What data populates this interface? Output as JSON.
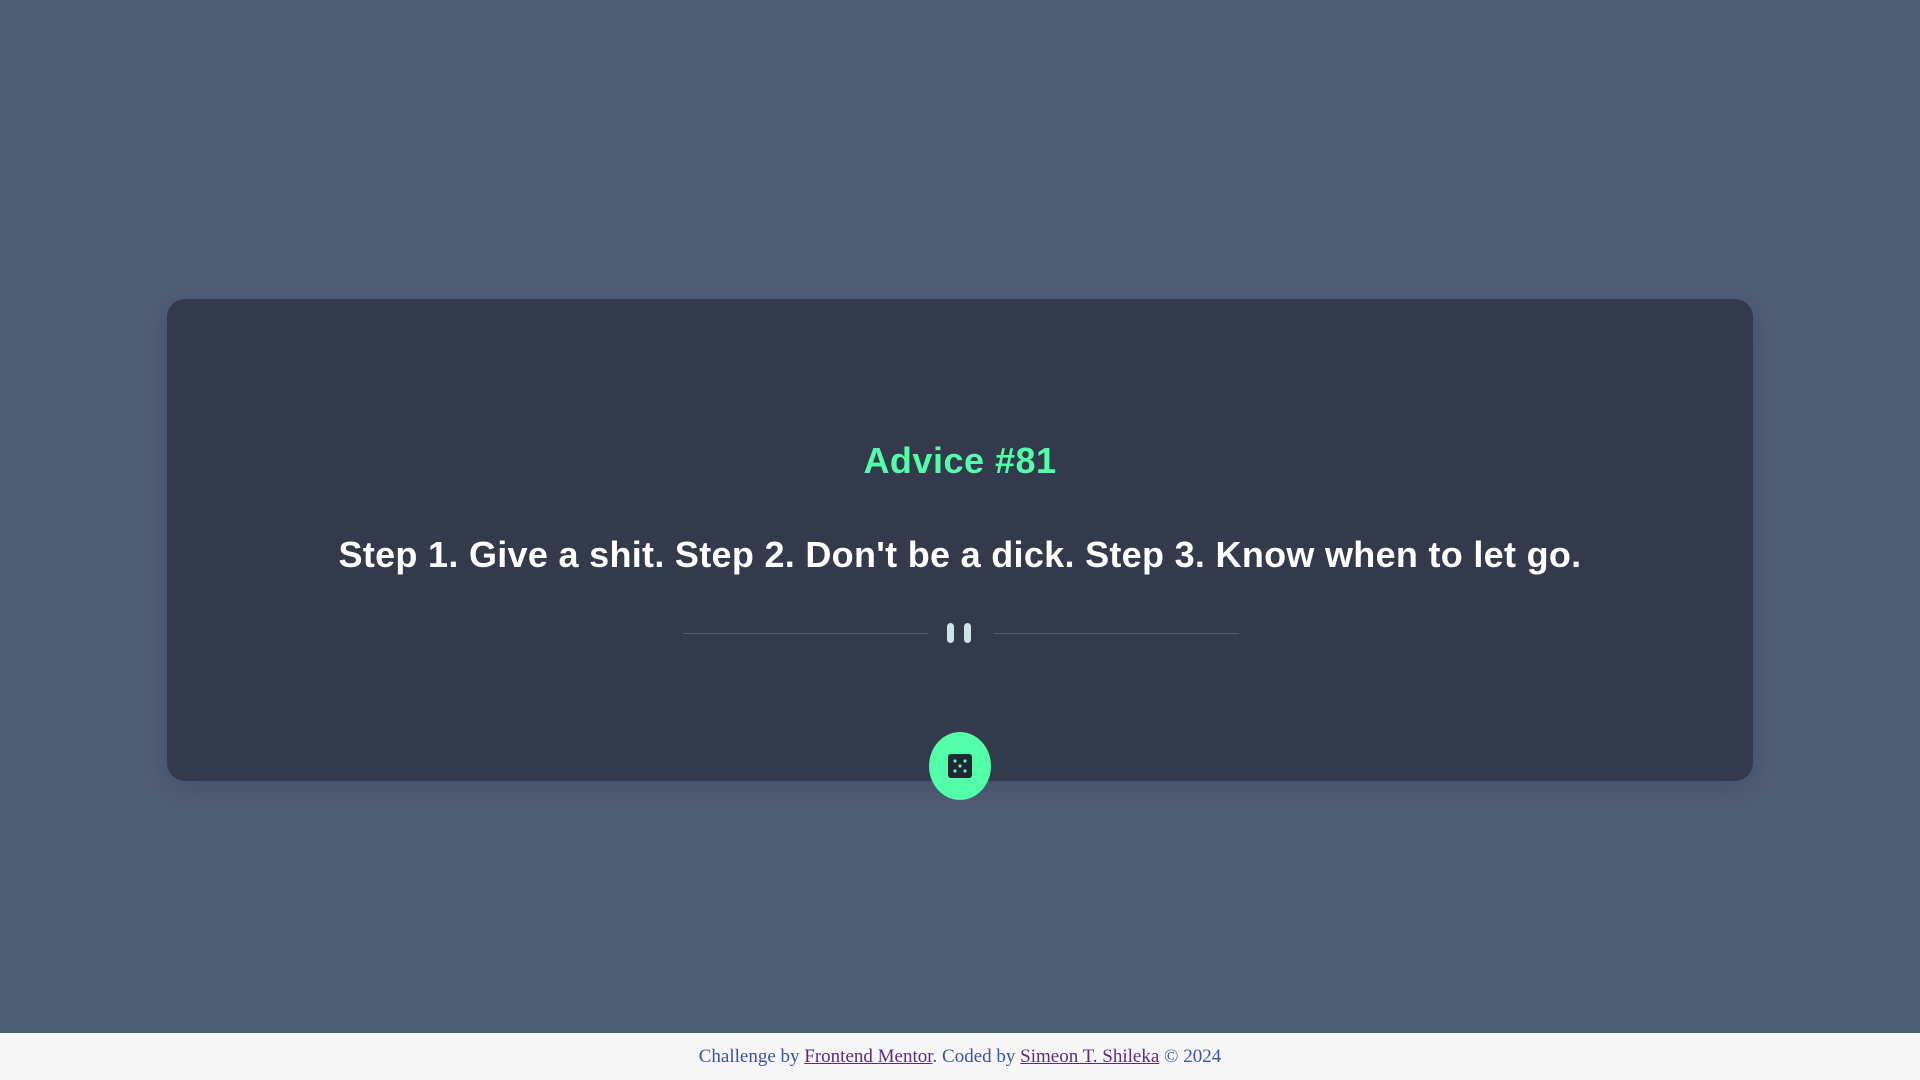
{
  "card": {
    "advice_label": "Advice #81",
    "advice_text": "Step 1. Give a shit. Step 2. Don't be a dick. Step 3. Know when to let go.",
    "divider_icon": "pause-icon",
    "button_icon": "dice-icon"
  },
  "footer": {
    "prefix": "Challenge by ",
    "link1": "Frontend Mentor",
    "middle": ". Coded by ",
    "link2": "Simeon T. Shileka",
    "suffix": " © 2024"
  },
  "colors": {
    "background": "#4f5d75",
    "card": "#323a4b",
    "accent": "#52ffa8",
    "text": "#ffffff",
    "divider": "#4f5d6e",
    "footer_bg": "#f7f7f7",
    "footer_text": "#3e52a3",
    "footer_link": "#5b2a86"
  }
}
